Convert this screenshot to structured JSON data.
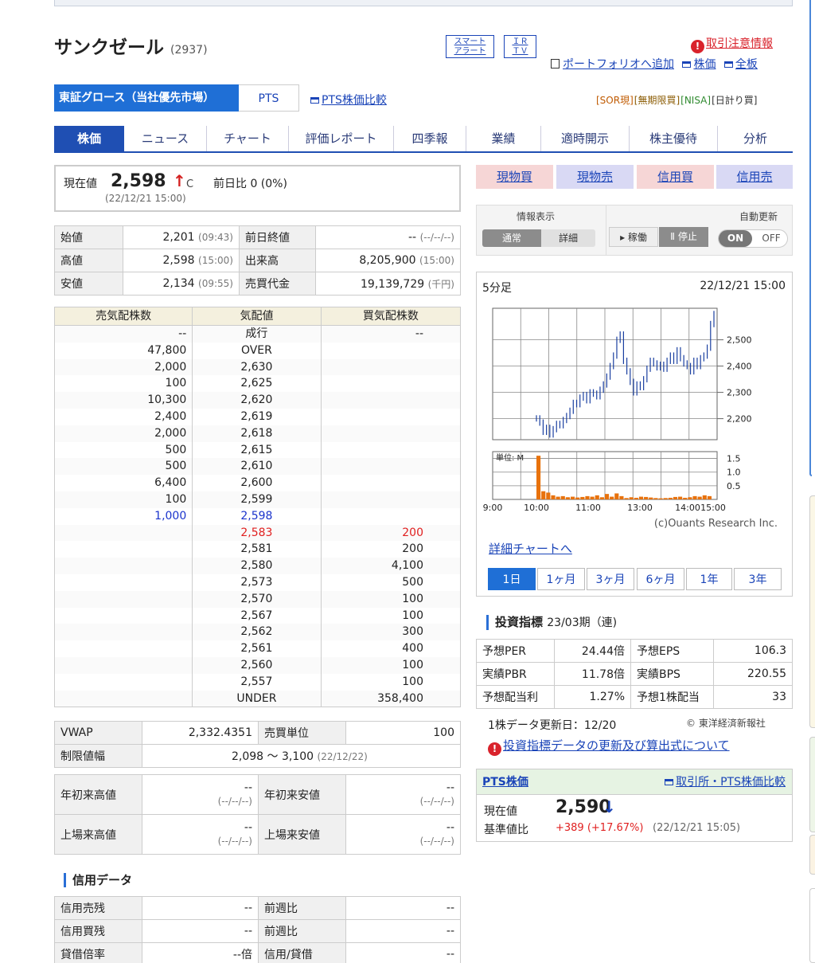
{
  "company": {
    "name": "サンクゼール",
    "code": "(2937)"
  },
  "header_buttons": {
    "smart_alert": "スマート\nアラート",
    "irtv": "ＩＲ\nＴＶ"
  },
  "header_links": {
    "alert_info": "取引注意情報",
    "portfolio": "ポートフォリオへ追加",
    "stock_price": "株価",
    "full_board": "全板"
  },
  "market_tabs": {
    "tse": "東証グロース（当社優先市場）",
    "pts": "PTS",
    "pts_compare": "PTS株価比較"
  },
  "tags": [
    "[SOR現]",
    "[無期限買]",
    "[NISA]",
    "[日計り買]"
  ],
  "nav_tabs": [
    "株価",
    "ニュース",
    "チャート",
    "評価レポート",
    "四季報",
    "業績",
    "適時開示",
    "株主優待",
    "分析"
  ],
  "price": {
    "label": "現在値",
    "value": "2,598",
    "arrow": "↑",
    "c": "C",
    "diff": "前日比 0 (0%)",
    "time": "(22/12/21 15:00)"
  },
  "summary": [
    {
      "k1": "始値",
      "v1": "2,201",
      "t1": "(09:43)",
      "k2": "前日終値",
      "v2": "--",
      "t2": "(--/--/--)"
    },
    {
      "k1": "高値",
      "v1": "2,598",
      "t1": "(15:00)",
      "k2": "出来高",
      "v2": "8,205,900",
      "t2": "(15:00)"
    },
    {
      "k1": "安値",
      "v1": "2,134",
      "t1": "(09:55)",
      "k2": "売買代金",
      "v2": "19,139,729",
      "t2": "(千円)"
    }
  ],
  "board": {
    "headers": [
      "売気配株数",
      "気配値",
      "買気配株数"
    ],
    "rows": [
      [
        "--",
        "成行",
        "--"
      ],
      [
        "47,800",
        "OVER",
        ""
      ],
      [
        "2,000",
        "2,630",
        ""
      ],
      [
        "100",
        "2,625",
        ""
      ],
      [
        "10,300",
        "2,620",
        ""
      ],
      [
        "2,400",
        "2,619",
        ""
      ],
      [
        "2,000",
        "2,618",
        ""
      ],
      [
        "500",
        "2,615",
        ""
      ],
      [
        "500",
        "2,610",
        ""
      ],
      [
        "6,400",
        "2,600",
        ""
      ],
      [
        "100",
        "2,599",
        ""
      ],
      [
        "1,000",
        "2,598",
        ""
      ],
      [
        "",
        "2,583",
        "200"
      ],
      [
        "",
        "2,581",
        "200"
      ],
      [
        "",
        "2,580",
        "4,100"
      ],
      [
        "",
        "2,573",
        "500"
      ],
      [
        "",
        "2,570",
        "100"
      ],
      [
        "",
        "2,567",
        "100"
      ],
      [
        "",
        "2,562",
        "300"
      ],
      [
        "",
        "2,561",
        "400"
      ],
      [
        "",
        "2,560",
        "100"
      ],
      [
        "",
        "2,557",
        "100"
      ],
      [
        "",
        "UNDER",
        "358,400"
      ]
    ],
    "colors": {
      "blue": "#1a33cc",
      "red": "#e02020"
    }
  },
  "vwap": {
    "label": "VWAP",
    "value": "2,332.4351",
    "unit_label": "売買単位",
    "unit_value": "100",
    "limit_label": "制限値幅",
    "limit_value": "2,098 ～ 3,100",
    "limit_date": "(22/12/22)"
  },
  "highs": [
    {
      "k1": "年初来高値",
      "v1": "--",
      "d1": "(--/--/--)",
      "k2": "年初来安値",
      "v2": "--",
      "d2": "(--/--/--)"
    },
    {
      "k1": "上場来高値",
      "v1": "--",
      "d1": "(--/--/--)",
      "k2": "上場来安値",
      "v2": "--",
      "d2": "(--/--/--)"
    }
  ],
  "credit": {
    "title": "信用データ",
    "rows": [
      {
        "k1": "信用売残",
        "v1": "--",
        "k2": "前週比",
        "v2": "--"
      },
      {
        "k1": "信用買残",
        "v1": "--",
        "k2": "前週比",
        "v2": "--"
      },
      {
        "k1": "貸借倍率",
        "v1": "--倍",
        "k2": "信用/貸借",
        "v2": "--"
      }
    ]
  },
  "trade_buttons": [
    {
      "label": "現物買",
      "color": "#f6d6d6"
    },
    {
      "label": "現物売",
      "color": "#d9d9f4"
    },
    {
      "label": "信用買",
      "color": "#f6d6d6"
    },
    {
      "label": "信用売",
      "color": "#d9d9f4"
    }
  ],
  "info_display": {
    "label": "情報表示",
    "normal": "通常",
    "detail": "詳細",
    "auto_label": "自動更新",
    "run": "▸ 稼働",
    "stop": "Ⅱ 停止",
    "on": "ON",
    "off": "OFF"
  },
  "chart_data": {
    "type": "candlestick",
    "interval": "5分足",
    "date": "22/12/21 15:00",
    "y_ticks": [
      "2,500",
      "2,400",
      "2,300",
      "2,200"
    ],
    "ylim": [
      2120,
      2620
    ],
    "volume_unit": "単位: M",
    "volume_ticks": [
      "1.5",
      "1.0",
      "0.5"
    ],
    "x_ticks": [
      "9:00",
      "10:00",
      "11:00",
      "13:00",
      "14:00",
      "15:00"
    ],
    "copyright": "(c)Ouants Research Inc.",
    "prices": [
      2201,
      2185,
      2150,
      2165,
      2140,
      2160,
      2180,
      2175,
      2195,
      2210,
      2230,
      2260,
      2255,
      2280,
      2290,
      2270,
      2300,
      2295,
      2285,
      2310,
      2330,
      2360,
      2400,
      2440,
      2500,
      2520,
      2420,
      2380,
      2340,
      2300,
      2330,
      2320,
      2350,
      2390,
      2420,
      2410,
      2395,
      2405,
      2390,
      2420,
      2440,
      2420,
      2460,
      2430,
      2410,
      2400,
      2380,
      2420,
      2400,
      2430,
      2440,
      2470,
      2560,
      2598
    ],
    "volume": [
      1.6,
      0.3,
      0.25,
      0.15,
      0.1,
      0.12,
      0.08,
      0.1,
      0.07,
      0.09,
      0.12,
      0.1,
      0.15,
      0.08,
      0.2,
      0.1,
      0.22,
      0.12,
      0.05,
      0.08,
      0.06,
      0.1,
      0.09,
      0.07,
      0.05,
      0.04,
      0.05,
      0.06,
      0.09,
      0.1,
      0.06,
      0.08,
      0.12,
      0.1,
      0.15,
      0.12
    ],
    "detail_link": "詳細チャートへ"
  },
  "periods": [
    "1日",
    "1ヶ月",
    "3ヶ月",
    "6ヶ月",
    "1年",
    "3年"
  ],
  "indicators": {
    "title": "投資指標",
    "period": "23/03期（連)",
    "rows": [
      {
        "k1": "予想PER",
        "v1": "24.44倍",
        "k2": "予想EPS",
        "v2": "106.3"
      },
      {
        "k1": "実績PBR",
        "v1": "11.78倍",
        "k2": "実績BPS",
        "v2": "220.55"
      },
      {
        "k1": "予想配当利",
        "v1": "1.27%",
        "k2": "予想1株配当",
        "v2": "33"
      }
    ],
    "update": "1株データ更新日：12/20",
    "source": "© 東洋経済新報社",
    "note_link": "投資指標データの更新及び算出式について"
  },
  "pts": {
    "title": "PTS株価",
    "link": "取引所・PTS株価比較",
    "price_label": "現在値",
    "price": "2,590",
    "arrow": "↓",
    "base_label": "基準値比",
    "diff": "+389 (+17.67%)",
    "time": "(22/12/21 15:05)"
  }
}
